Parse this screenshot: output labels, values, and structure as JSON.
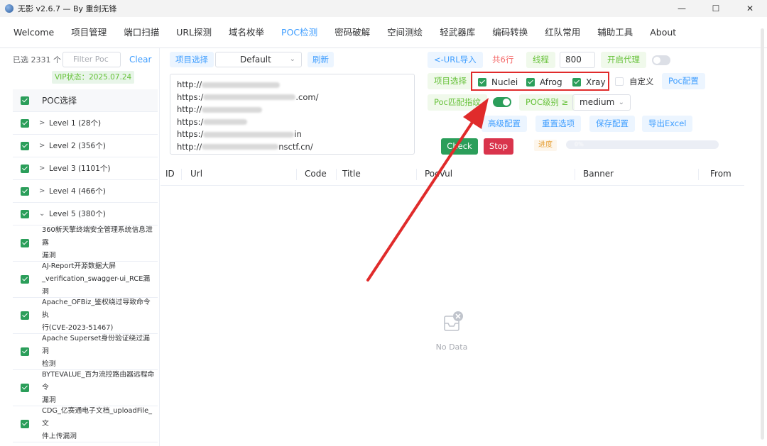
{
  "window": {
    "title": "无影 v2.6.7 — By 重剑无锋",
    "minimize": "—",
    "maximize": "☐",
    "close": "✕"
  },
  "menu": [
    "Welcome",
    "项目管理",
    "端口扫描",
    "URL探测",
    "域名枚举",
    "POC检测",
    "密码破解",
    "空间测绘",
    "轻武器库",
    "编码转换",
    "红队常用",
    "辅助工具",
    "About"
  ],
  "menu_active": "POC检测",
  "left": {
    "selected": "已选 2331 个",
    "filter_placeholder": "Filter Poc",
    "clear": "Clear",
    "vip": "VIP状态：2025.07.24",
    "tree_header": "POC选择",
    "levels": [
      {
        "label": "Level 1 (28个)",
        "expanded": false
      },
      {
        "label": "Level 2 (356个)",
        "expanded": false
      },
      {
        "label": "Level 3 (1101个)",
        "expanded": false
      },
      {
        "label": "Level 4 (466个)",
        "expanded": false
      },
      {
        "label": "Level 5 (380个)",
        "expanded": true
      }
    ],
    "pocs": [
      {
        "l1": "360新天擎终端安全管理系统信息泄露",
        "l2": "漏洞"
      },
      {
        "l1": "AJ-Report开源数据大屏",
        "l2": "_verification_swagger-ui_RCE漏洞"
      },
      {
        "l1": "Apache_OFBiz_鉴权绕过导致命令执",
        "l2": "行(CVE-2023-51467)"
      },
      {
        "l1": "Apache Superset身份验证绕过漏洞",
        "l2": "检测"
      },
      {
        "l1": "BYTEVALUE_百为流控路由器远程命令",
        "l2": "漏洞"
      },
      {
        "l1": "CDG_亿赛通电子文档_uploadFile_文",
        "l2": "件上传漏洞"
      }
    ]
  },
  "center": {
    "project_label": "项目选择",
    "project_value": "Default",
    "refresh": "刷新",
    "urls": [
      {
        "prefix": "http://",
        "suffix": ""
      },
      {
        "prefix": "https:/",
        "suffix": ".com/"
      },
      {
        "prefix": "http://",
        "suffix": ""
      },
      {
        "prefix": "https:/",
        "suffix": ""
      },
      {
        "prefix": "https:/",
        "suffix": "in"
      },
      {
        "prefix": "http://",
        "suffix": "nsctf.cn/"
      }
    ]
  },
  "controls": {
    "url_import": "<-URL导入",
    "total_lines": "共6行",
    "thread_label": "线程",
    "thread_value": "800",
    "proxy_label": "开启代理",
    "project_select": "项目选择",
    "engines": [
      "Nuclei",
      "Afrog",
      "Xray"
    ],
    "custom": "自定义",
    "poc_config": "Poc配置",
    "fingerprint": "Poc匹配指纹",
    "poc_level_label": "POC级别 ≥",
    "poc_level_value": "medium",
    "advanced": "高级配置",
    "reset": "重置选项",
    "save": "保存配置",
    "export": "导出Excel",
    "check": "Check",
    "stop": "Stop",
    "progress_label": "进度",
    "progress_text": "0%"
  },
  "table": {
    "columns": [
      "ID",
      "Url",
      "Code",
      "Title",
      "PocVul",
      "Banner",
      "From"
    ],
    "empty": "No Data"
  },
  "colors": {
    "accent": "#409eff",
    "green": "#2b9e5a",
    "red": "#d9344c",
    "annotation": "#e02b2b"
  }
}
